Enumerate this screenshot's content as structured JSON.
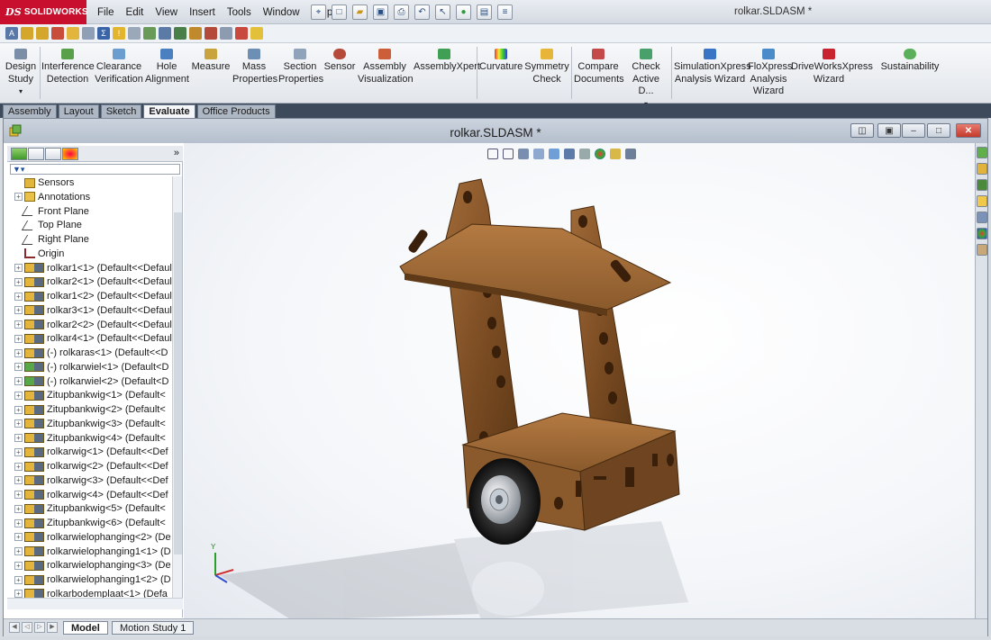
{
  "app": {
    "brand": "SOLIDWORKS",
    "window_title": "rolkar.SLDASM *"
  },
  "menu": [
    "File",
    "Edit",
    "View",
    "Insert",
    "Tools",
    "Window",
    "Help"
  ],
  "toolbar": {
    "design_study": "Design Study",
    "items": [
      {
        "label": "Interference Detection",
        "icon": "interference-icon"
      },
      {
        "label": "Clearance Verification",
        "icon": "clearance-icon"
      },
      {
        "label": "Hole Alignment",
        "icon": "hole-icon"
      },
      {
        "label": "Measure",
        "icon": "ruler-icon"
      },
      {
        "label": "Mass Properties",
        "icon": "scale-icon"
      },
      {
        "label": "Section Properties",
        "icon": "section-icon"
      },
      {
        "label": "Sensor",
        "icon": "sensor-icon"
      },
      {
        "label": "Assembly Visualization",
        "icon": "visualization-icon"
      },
      {
        "label": "AssemblyXpert",
        "icon": "xpert-icon"
      },
      {
        "label": "Curvature",
        "icon": "curvature-icon"
      },
      {
        "label": "Symmetry Check",
        "icon": "symmetry-icon"
      },
      {
        "label": "Compare Documents",
        "icon": "compare-icon"
      },
      {
        "label": "Check Active D...",
        "icon": "check-icon"
      },
      {
        "label": "SimulationXpress Analysis Wizard",
        "icon": "simulation-icon"
      },
      {
        "label": "FloXpress Analysis Wizard",
        "icon": "floxpress-icon"
      },
      {
        "label": "DriveWorksXpress Wizard",
        "icon": "driveworks-icon"
      },
      {
        "label": "Sustainability",
        "icon": "sustainability-icon"
      }
    ]
  },
  "tabs": [
    {
      "label": "Assembly",
      "active": false
    },
    {
      "label": "Layout",
      "active": false
    },
    {
      "label": "Sketch",
      "active": false
    },
    {
      "label": "Evaluate",
      "active": true
    },
    {
      "label": "Office Products",
      "active": false
    }
  ],
  "document": {
    "title": "rolkar.SLDASM *"
  },
  "feature_tree": {
    "expand_arrow": "»",
    "items": [
      {
        "label": "Sensors",
        "type": "folder",
        "expand": false
      },
      {
        "label": "Annotations",
        "type": "annotation",
        "expand": true
      },
      {
        "label": "Front Plane",
        "type": "plane",
        "expand": false
      },
      {
        "label": "Top Plane",
        "type": "plane",
        "expand": false
      },
      {
        "label": "Right Plane",
        "type": "plane",
        "expand": false
      },
      {
        "label": "Origin",
        "type": "origin",
        "expand": false
      },
      {
        "label": "rolkar1<1> (Default<<Defaul",
        "type": "part",
        "expand": true
      },
      {
        "label": "rolkar2<1> (Default<<Defaul",
        "type": "part",
        "expand": true
      },
      {
        "label": "rolkar1<2> (Default<<Defaul",
        "type": "part",
        "expand": true
      },
      {
        "label": "rolkar3<1> (Default<<Defaul",
        "type": "part",
        "expand": true
      },
      {
        "label": "rolkar2<2> (Default<<Defaul",
        "type": "part",
        "expand": true
      },
      {
        "label": "rolkar4<1> (Default<<Defaul",
        "type": "part",
        "expand": true
      },
      {
        "label": "(-) rolkaras<1> (Default<<D",
        "type": "part",
        "expand": true
      },
      {
        "label": "(-) rolkarwiel<1> (Default<D",
        "type": "part-green",
        "expand": true
      },
      {
        "label": "(-) rolkarwiel<2> (Default<D",
        "type": "part-green",
        "expand": true
      },
      {
        "label": "Zitupbankwig<1> (Default<",
        "type": "part",
        "expand": true
      },
      {
        "label": "Zitupbankwig<2> (Default<",
        "type": "part",
        "expand": true
      },
      {
        "label": "Zitupbankwig<3> (Default<",
        "type": "part",
        "expand": true
      },
      {
        "label": "Zitupbankwig<4> (Default<",
        "type": "part",
        "expand": true
      },
      {
        "label": "rolkarwig<1> (Default<<Def",
        "type": "part",
        "expand": true
      },
      {
        "label": "rolkarwig<2> (Default<<Def",
        "type": "part",
        "expand": true
      },
      {
        "label": "rolkarwig<3> (Default<<Def",
        "type": "part",
        "expand": true
      },
      {
        "label": "rolkarwig<4> (Default<<Def",
        "type": "part",
        "expand": true
      },
      {
        "label": "Zitupbankwig<5> (Default<",
        "type": "part",
        "expand": true
      },
      {
        "label": "Zitupbankwig<6> (Default<",
        "type": "part",
        "expand": true
      },
      {
        "label": "rolkarwielophanging<2> (De",
        "type": "part",
        "expand": true
      },
      {
        "label": "rolkarwielophanging1<1> (D",
        "type": "part",
        "expand": true
      },
      {
        "label": "rolkarwielophanging<3> (De",
        "type": "part",
        "expand": true
      },
      {
        "label": "rolkarwielophanging1<2> (D",
        "type": "part",
        "expand": true
      },
      {
        "label": "rolkarbodemplaat<1> (Defa",
        "type": "part",
        "expand": true
      }
    ]
  },
  "bottom_tabs": [
    {
      "label": "Model",
      "active": true
    },
    {
      "label": "Motion Study 1",
      "active": false
    }
  ],
  "colors": {
    "brand": "#c8102e",
    "wood": "#8b5a2b",
    "wood_dark": "#5e3a18",
    "tab_bar": "#3d4a5c"
  }
}
